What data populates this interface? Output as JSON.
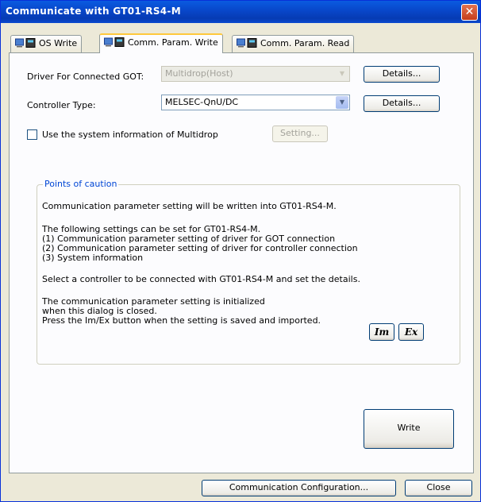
{
  "window": {
    "title": "Communicate with GT01-RS4-M"
  },
  "tabs": [
    {
      "label": "OS Write"
    },
    {
      "label": "Comm. Param. Write"
    },
    {
      "label": "Comm. Param. Read"
    }
  ],
  "driver": {
    "label": "Driver For Connected GOT:",
    "value": "Multidrop(Host)",
    "details_label": "Details..."
  },
  "controller": {
    "label": "Controller Type:",
    "value": "MELSEC-QnU/DC",
    "details_label": "Details..."
  },
  "system_info": {
    "checkbox_label": "Use the system information of Multidrop",
    "checked": false,
    "setting_label": "Setting..."
  },
  "caution": {
    "title": "Points of caution",
    "lines": [
      "Communication parameter setting will be written into GT01-RS4-M.",
      "The following settings can be set for GT01-RS4-M.",
      "(1) Communication parameter setting of driver for GOT connection",
      "(2) Communication parameter setting of driver for controller connection",
      "(3) System information",
      "Select a controller to be connected with GT01-RS4-M and set the details.",
      "The communication parameter setting is initialized",
      "when this dialog is closed.",
      "Press the Im/Ex button when the setting is saved and imported."
    ],
    "im_label": "Im",
    "ex_label": "Ex"
  },
  "write_label": "Write",
  "footer": {
    "comm_config_label": "Communication Configuration...",
    "close_label": "Close"
  }
}
